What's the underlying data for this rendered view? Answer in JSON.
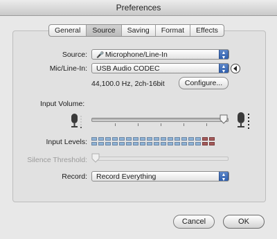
{
  "window": {
    "title": "Preferences"
  },
  "tabs": [
    {
      "label": "General",
      "active": false
    },
    {
      "label": "Source",
      "active": true
    },
    {
      "label": "Saving",
      "active": false
    },
    {
      "label": "Format",
      "active": false
    },
    {
      "label": "Effects",
      "active": false
    }
  ],
  "source": {
    "label": "Source:",
    "value": "Microphone/Line-In"
  },
  "mic_line_in": {
    "label": "Mic/Line-In:",
    "value": "USB Audio CODEC"
  },
  "format_info": "44,100.0 Hz, 2ch-16bit",
  "configure_button": "Configure...",
  "input_volume": {
    "label": "Input Volume:",
    "level": 0.95
  },
  "input_levels": {
    "label": "Input Levels:",
    "segments": 18,
    "red_segments": 2
  },
  "silence_threshold": {
    "label": "Silence Threshold:",
    "level": 0.0
  },
  "record": {
    "label": "Record:",
    "value": "Record Everything"
  },
  "buttons": {
    "cancel": "Cancel",
    "ok": "OK"
  },
  "colors": {
    "popup_arrow": "#2f5fae",
    "level_blue": "#8fb3d6",
    "level_red": "#a45b5b"
  }
}
